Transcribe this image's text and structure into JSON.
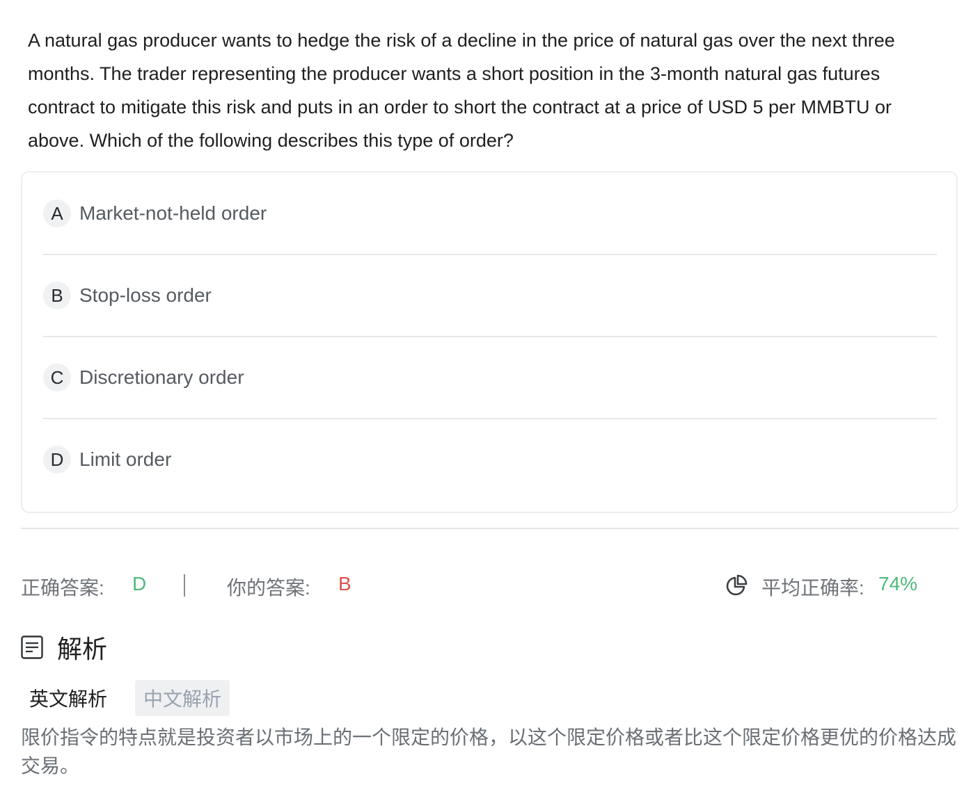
{
  "question": {
    "text": "A natural gas producer wants to hedge the risk of a decline in the price of natural gas over the next three months. The trader representing the producer wants a short position in the 3-month natural gas futures contract to mitigate this risk and puts in an order to short the contract at a price of USD 5 per MMBTU or above. Which of the following describes this type of order?"
  },
  "options": [
    {
      "letter": "A",
      "text": "Market-not-held order"
    },
    {
      "letter": "B",
      "text": "Stop-loss order"
    },
    {
      "letter": "C",
      "text": "Discretionary order"
    },
    {
      "letter": "D",
      "text": "Limit order"
    }
  ],
  "result": {
    "correct_label": "正确答案:",
    "correct_value": "D",
    "yours_label": "你的答案:",
    "yours_value": "B",
    "rate_label": "平均正确率:",
    "rate_value": "74%"
  },
  "analysis": {
    "title": "解析",
    "tabs": [
      "英文解析",
      "中文解析"
    ],
    "text": "限价指令的特点就是投资者以市场上的一个限定的价格，以这个限定价格或者比这个限定价格更优的价格达成交易。"
  },
  "icons": {
    "stats": "pie-chart-icon",
    "analysis": "document-icon"
  },
  "colors": {
    "correct": "#4fb97a",
    "wrong": "#d9534f",
    "border": "#eceef1"
  }
}
